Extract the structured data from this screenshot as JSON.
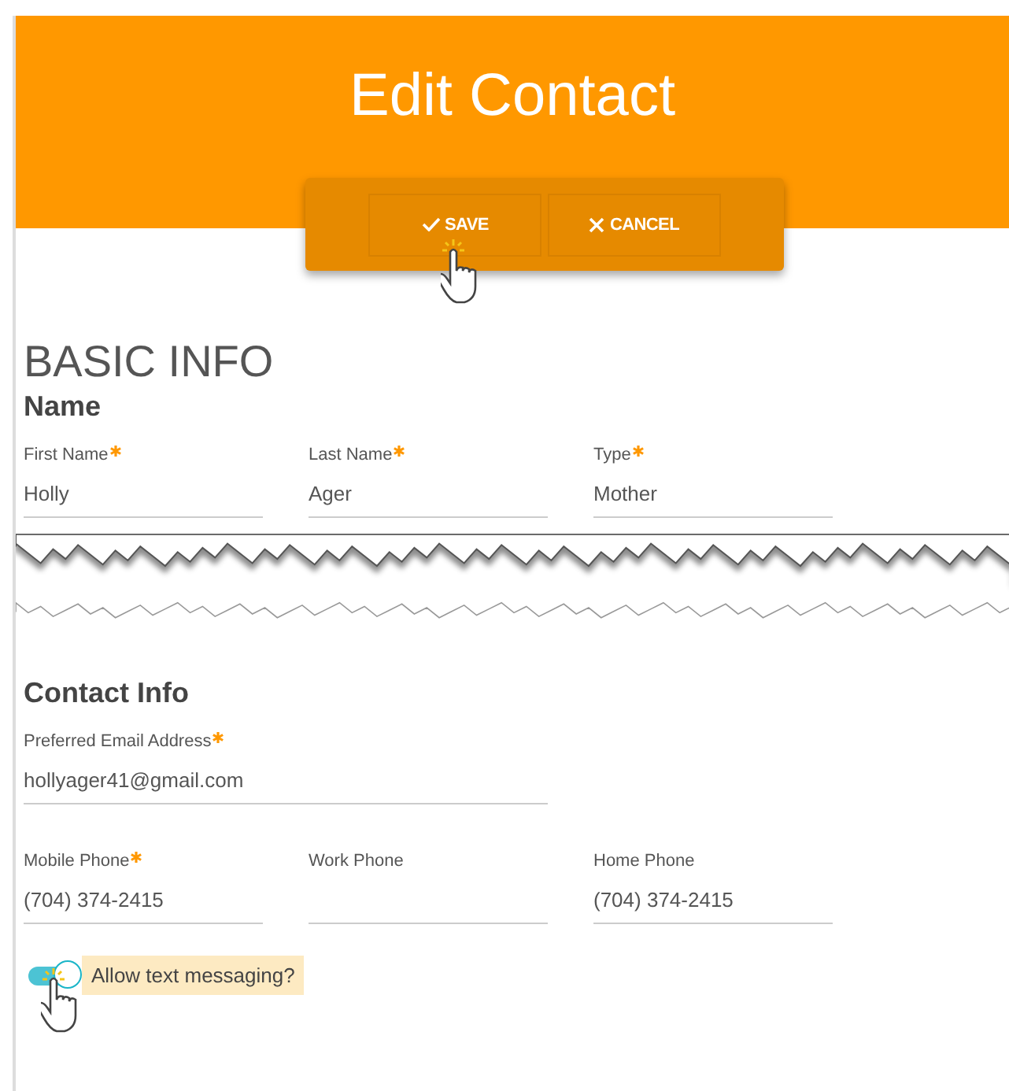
{
  "header": {
    "title": "Edit Contact"
  },
  "actions": [
    {
      "kind": "save",
      "label": "SAVE"
    },
    {
      "kind": "cancel",
      "label": "CANCEL"
    }
  ],
  "section_title": "BASIC INFO",
  "name_group": {
    "title": "Name",
    "fields": [
      {
        "label": "First Name",
        "required": true,
        "value": "Holly"
      },
      {
        "label": "Last Name",
        "required": true,
        "value": "Ager"
      },
      {
        "label": "Type",
        "required": true,
        "value": "Mother"
      }
    ]
  },
  "contact_group": {
    "title": "Contact Info",
    "email": {
      "label": "Preferred Email Address",
      "required": true,
      "value": "hollyager41@gmail.com"
    },
    "phones": [
      {
        "label": "Mobile Phone",
        "required": true,
        "value": "(704) 374-2415"
      },
      {
        "label": "Work Phone",
        "required": false
      },
      {
        "label": "Home Phone",
        "required": false,
        "value": "(704) 374-2415"
      }
    ]
  },
  "text_messaging": {
    "label": "Allow text messaging?",
    "on": true
  }
}
